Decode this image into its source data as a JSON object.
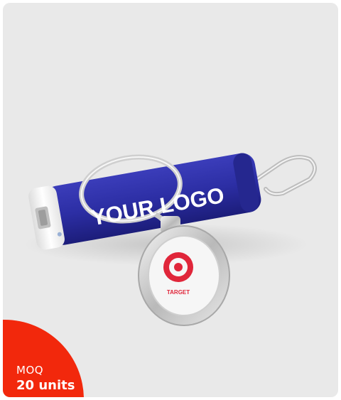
{
  "product": {
    "logo_text": "YOUR LOGO",
    "keyring_logo_text": "TARGET",
    "colors": {
      "background": "#e9e9e9",
      "body": "#2d2fa3",
      "cap": "#f2f2f2",
      "metal": "#d6d6d6",
      "badge": "#f2280c",
      "target_red": "#e0263a"
    }
  },
  "badge": {
    "label": "MOQ",
    "value": "20 units"
  }
}
